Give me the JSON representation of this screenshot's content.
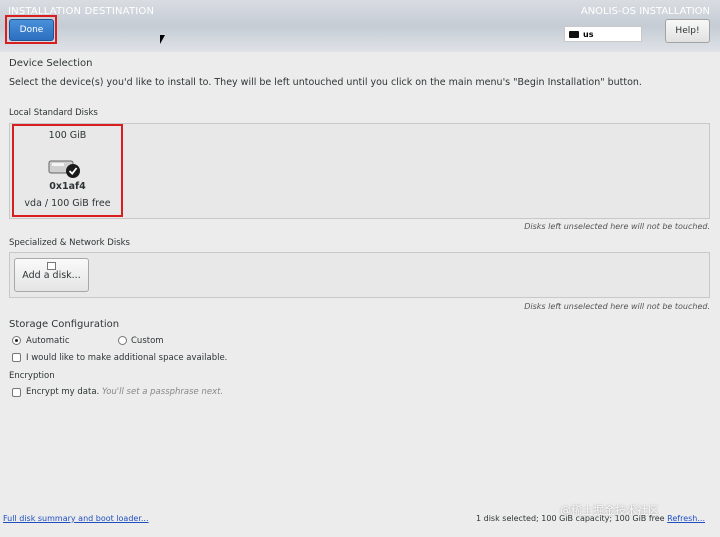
{
  "header": {
    "title": "INSTALLATION DESTINATION",
    "right_text": "ANOLIS-OS INSTALLATION",
    "done_label": "Done",
    "keyboard_layout": "us",
    "help_label": "Help!"
  },
  "device_selection": {
    "title": "Device Selection",
    "description": "Select the device(s) you'd like to install to.  They will be left untouched until you click on the main menu's \"Begin Installation\" button."
  },
  "local_disks": {
    "title": "Local Standard Disks",
    "disks": [
      {
        "size": "100 GiB",
        "name": "0x1af4",
        "free": "vda  /  100 GiB free"
      }
    ],
    "note": "Disks left unselected here will not be touched."
  },
  "network_disks": {
    "title": "Specialized & Network Disks",
    "add_label": "Add a disk...",
    "note": "Disks left unselected here will not be touched."
  },
  "storage_config": {
    "title": "Storage Configuration",
    "automatic": "Automatic",
    "custom": "Custom",
    "additional_space": "I would like to make additional space available."
  },
  "encryption": {
    "title": "Encryption",
    "encrypt_label": "Encrypt my data.",
    "encrypt_hint": "You'll set a passphrase next."
  },
  "footer": {
    "summary_link": "Full disk summary and boot loader...",
    "status": "1 disk selected; 100 GiB capacity; 100 GiB free",
    "refresh": "Refresh..."
  },
  "watermark": "@稀土掘金技术社区"
}
